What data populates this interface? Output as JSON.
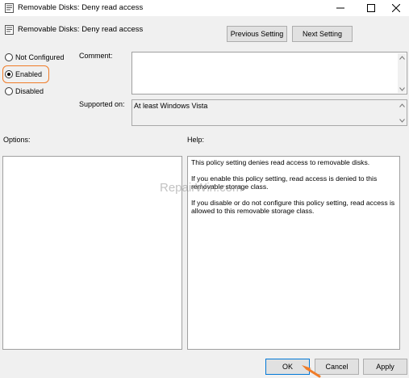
{
  "window": {
    "title": "Removable Disks: Deny read access",
    "controls": {
      "minimize": "minimize-icon",
      "maximize": "maximize-icon",
      "close": "close-icon"
    }
  },
  "header": {
    "policy_name": "Removable Disks: Deny read access",
    "previous_label": "Previous Setting",
    "next_label": "Next Setting"
  },
  "state": {
    "options": [
      {
        "label": "Not Configured",
        "checked": false
      },
      {
        "label": "Enabled",
        "checked": true
      },
      {
        "label": "Disabled",
        "checked": false
      }
    ],
    "highlight_color": "#f07c28"
  },
  "comment": {
    "label": "Comment:",
    "value": ""
  },
  "supported": {
    "label": "Supported on:",
    "value": "At least Windows Vista"
  },
  "options_panel": {
    "label": "Options:"
  },
  "help_panel": {
    "label": "Help:",
    "paragraphs": [
      "This policy setting denies read access to removable disks.",
      "If you enable this policy setting, read access is denied to this removable storage class.",
      "If you disable or do not configure this policy setting, read access is allowed to this removable storage class."
    ]
  },
  "watermark": "RepairWin.com",
  "footer": {
    "ok_label": "OK",
    "cancel_label": "Cancel",
    "apply_label": "Apply",
    "accent": "#0078d7"
  }
}
